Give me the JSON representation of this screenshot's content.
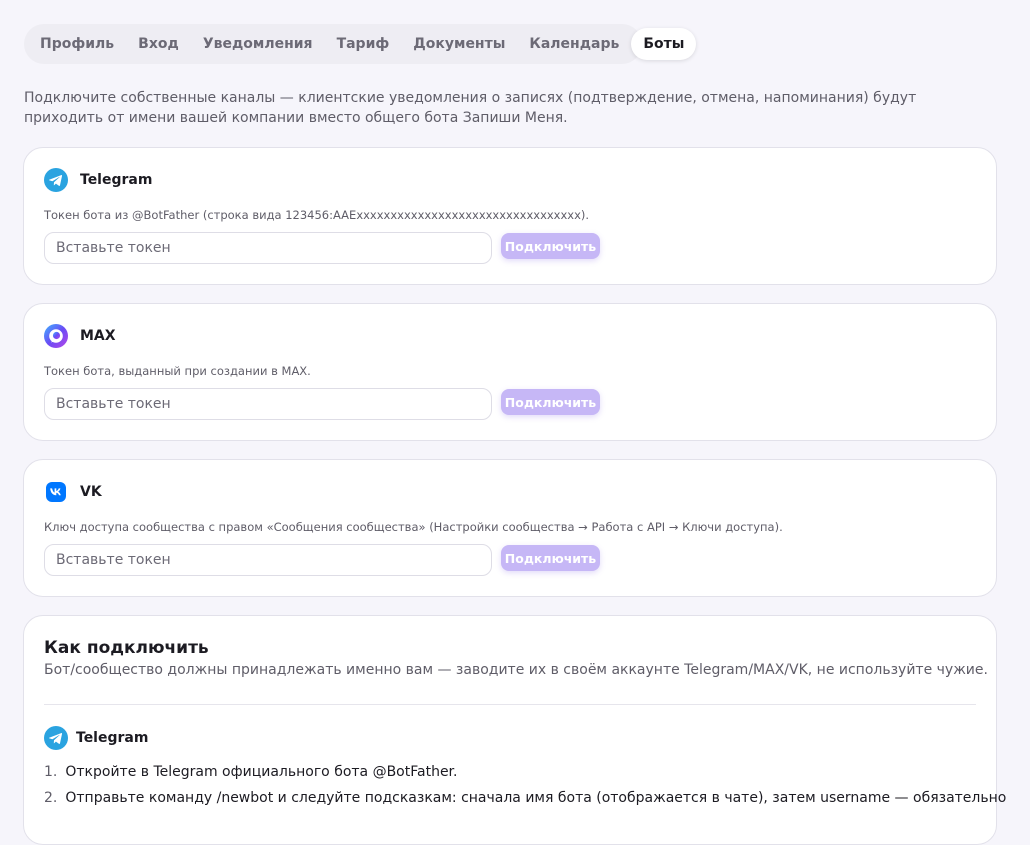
{
  "tabs": [
    "Профиль",
    "Вход",
    "Уведомления",
    "Тариф",
    "Документы",
    "Календарь",
    "Боты"
  ],
  "active_tab": "Боты",
  "intro": "Подключите собственные каналы — клиентские уведомления о записях (подтверждение, отмена, напоминания) будут приходить от имени вашей компании вместо общего бота Запиши Меня.",
  "bots": [
    {
      "name": "Telegram",
      "icon": "telegram-icon",
      "hint": "Токен бота из @BotFather (строка вида 123456:AAExxxxxxxxxxxxxxxxxxxxxxxxxxxxxxxxx).",
      "placeholder": "Вставьте токен",
      "button": "Подключить"
    },
    {
      "name": "MAX",
      "icon": "max-icon",
      "hint": "Токен бота, выданный при создании в MAX.",
      "placeholder": "Вставьте токен",
      "button": "Подключить"
    },
    {
      "name": "VK",
      "icon": "vk-icon",
      "hint": "Ключ доступа сообщества с правом «Сообщения сообщества» (Настройки сообщества → Работа с API → Ключи доступа).",
      "placeholder": "Вставьте токен",
      "button": "Подключить"
    }
  ],
  "how_to": {
    "title": "Как подключить",
    "subtitle": "Бот/сообщество должны принадлежать именно вам — заводите их в своём аккаунте Telegram/MAX/VK, не используйте чужие.",
    "section": "Telegram",
    "steps": [
      {
        "num": "1.",
        "text": "Откройте в Telegram официального бота @BotFather."
      },
      {
        "num": "2.",
        "text": "Отправьте команду /newbot и следуйте подсказкам: сначала имя бота (отображается в чате), затем username — обязательно"
      }
    ]
  },
  "colors": {
    "accent": "#c6b7f6",
    "telegram": "#2aa3e0",
    "vk": "#0077ff",
    "background": "#f6f5fb"
  }
}
